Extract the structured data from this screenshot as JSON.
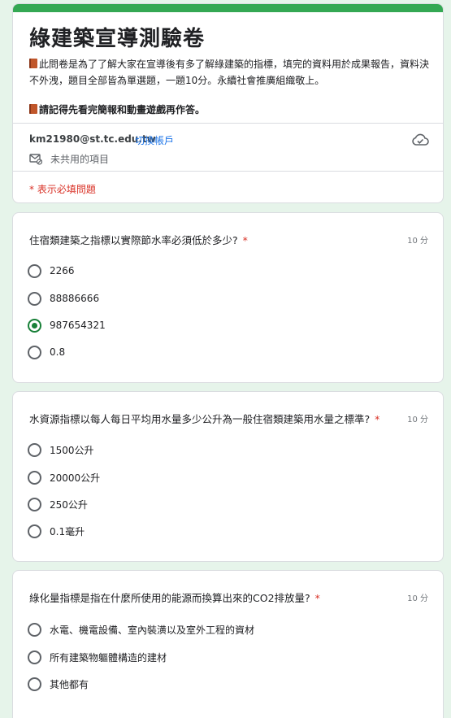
{
  "form": {
    "title": "綠建築宣導測驗卷",
    "description": "此問卷是為了了解大家在宣導後有多了解綠建築的指標，填完的資料用於成果報告，資料決不外洩，題目全部皆為單選題，一題10分。永續社會推廣組織敬上。",
    "notice": "請記得先看完簡報和動畫遊戲再作答。",
    "account_email": "km21980@st.tc.edu.tw",
    "switch_account": "切換帳戶",
    "unshared_label": "未共用的項目",
    "required_note": "* 表示必填問題",
    "accent_color": "#34a853",
    "selected_color": "#188038"
  },
  "questions": [
    {
      "text": "住宿類建築之指標以實際節水率必須低於多少?",
      "required_mark": "*",
      "points": "10 分",
      "options": [
        "2266",
        "88886666",
        "987654321",
        "0.8"
      ],
      "selected": "987654321"
    },
    {
      "text": "水資源指標以每人每日平均用水量多少公升為一般住宿類建築用水量之標準?",
      "required_mark": "*",
      "points": "10 分",
      "options": [
        "1500公升",
        "20000公升",
        "250公升",
        "0.1毫升"
      ],
      "selected": null
    },
    {
      "text": "綠化量指標是指在什麼所使用的能源而換算出來的CO2排放量?",
      "required_mark": "*",
      "points": "10 分",
      "options": [
        "水電、機電設備、室內裝潢以及室外工程的資材",
        "所有建築物軀體構造的建材",
        "其他都有"
      ],
      "selected": null
    }
  ],
  "icons": {
    "header": [
      "book-icon",
      "cloud-check-icon",
      "mail-icon"
    ],
    "option": "radio-button"
  }
}
